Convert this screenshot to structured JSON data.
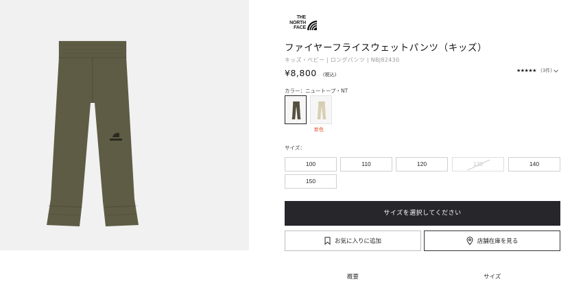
{
  "brand": {
    "logo_text_lines": [
      "THE",
      "NORTH",
      "FACE"
    ]
  },
  "product": {
    "title": "ファイヤーフライスウェットパンツ（キッズ）",
    "breadcrumb": "キッズ・ベビー | ロングパンツ | NBJ82430",
    "price": "¥8,800",
    "tax_label": "(税込)",
    "rating_stars": "★★★★★",
    "rating_count": "(3件)",
    "main_image_color": "#5f5c45"
  },
  "color_selector": {
    "label": "カラー：ニュートープ・NT",
    "swatches": [
      {
        "name": "ニュートープ",
        "color": "#55513f",
        "selected": true
      },
      {
        "name": "beige",
        "color": "#d9cfb4",
        "selected": false,
        "badge": "新色"
      }
    ]
  },
  "size_selector": {
    "label": "サイズ：",
    "sizes": [
      {
        "label": "100",
        "available": true
      },
      {
        "label": "110",
        "available": true
      },
      {
        "label": "120",
        "available": true
      },
      {
        "label": "130",
        "available": false
      },
      {
        "label": "140",
        "available": true
      },
      {
        "label": "150",
        "available": true
      }
    ]
  },
  "buttons": {
    "select_size": "サイズを選択してください",
    "favorite": "お気に入りに追加",
    "store_stock": "店舗在庫を見る"
  },
  "tabs": [
    "概要",
    "サイズ"
  ]
}
